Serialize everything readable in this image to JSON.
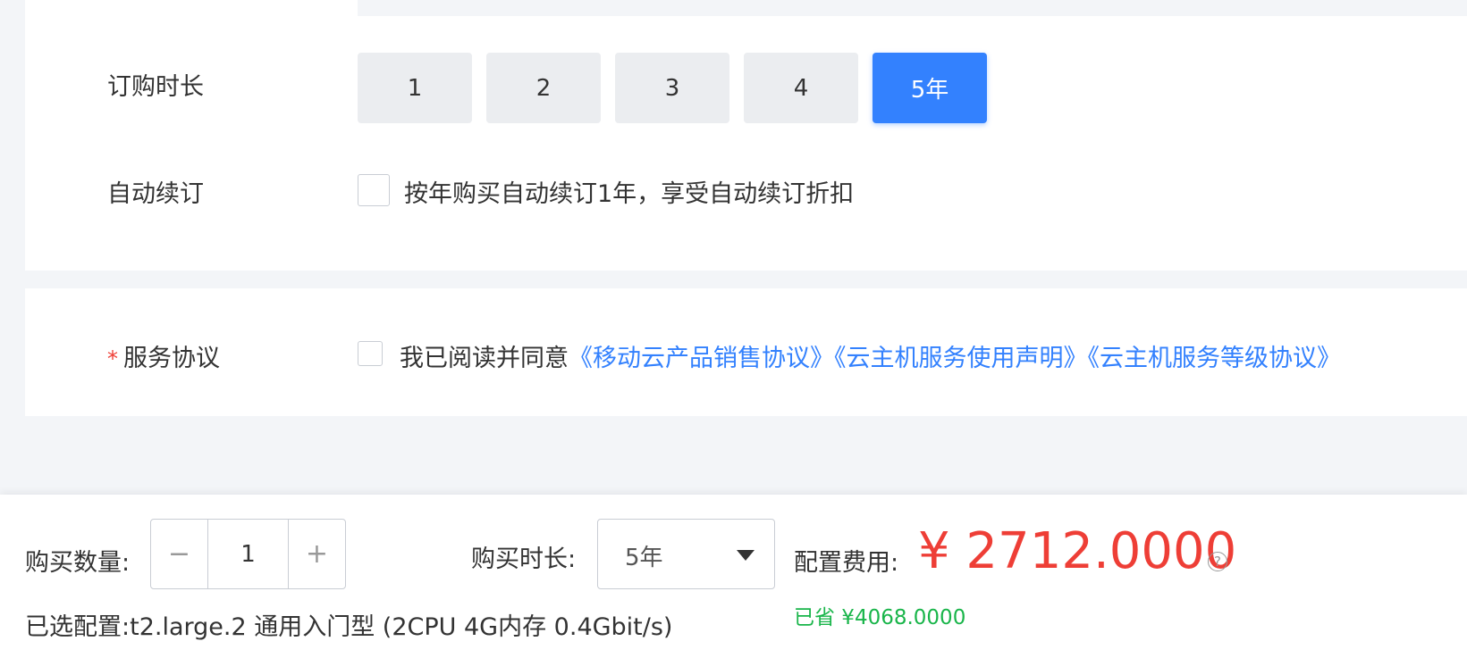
{
  "subscription": {
    "duration_label": "订购时长",
    "duration_options": [
      "1",
      "2",
      "3",
      "4",
      "5年"
    ],
    "selected_duration": "5年",
    "auto_renew_label": "自动续订",
    "auto_renew_text": "按年购买自动续订1年，享受自动续订折扣",
    "auto_renew_checked": false
  },
  "agreement": {
    "required_mark": "*",
    "label": "服务协议",
    "prefix": "我已阅读并同意",
    "links": [
      "《移动云产品销售协议》",
      "《云主机服务使用声明》",
      "《云主机服务等级协议》"
    ],
    "checked": false
  },
  "footer": {
    "quantity_label": "购买数量:",
    "quantity_value": "1",
    "decrement_symbol": "−",
    "increment_symbol": "+",
    "duration_label": "购买时长:",
    "duration_value": "5年",
    "cost_label": "配置费用:",
    "price": "¥ 2712.0000",
    "saved": "已省 ¥4068.0000",
    "help_symbol": "?",
    "selected_config_label": "已选配置:",
    "selected_config_value": "t2.large.2 通用入门型 (2CPU 4G内存 0.4Gbit/s)"
  },
  "colors": {
    "accent": "#3381fe",
    "price": "#ee3e36",
    "saved": "#19b54a",
    "background": "#f3f5f8"
  },
  "icons": {
    "duration_select": "chevron-down-icon",
    "price_help": "question-circle-icon"
  }
}
